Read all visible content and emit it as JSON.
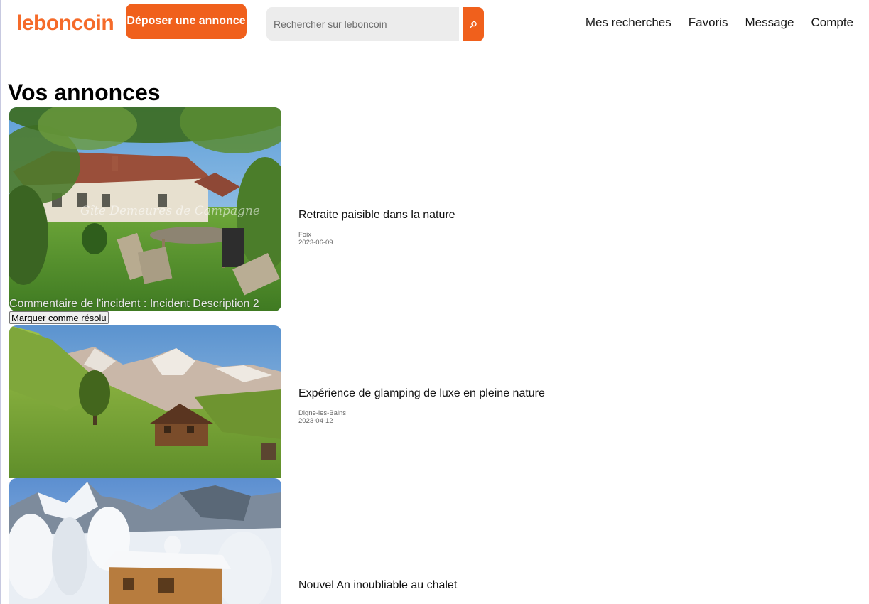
{
  "header": {
    "logo": "leboncoin",
    "post_button": "Déposer une annonce",
    "search_placeholder": "Rechercher sur leboncoin",
    "search_icon": "search-icon",
    "nav": [
      "Mes recherches",
      "Favoris",
      "Message",
      "Compte"
    ]
  },
  "colors": {
    "brand": "#f56b2a",
    "button": "#f0601c"
  },
  "main": {
    "title": "Vos annonces",
    "listings": [
      {
        "title": "Retraite paisible dans la nature",
        "city": "Foix",
        "date": "2023-06-09",
        "image": "cottage-garden-photo",
        "image_watermark": "Gîte Demeures de Campagne",
        "incident": "Commentaire de l'incident : Incident Description 2",
        "resolve_button": "Marquer comme résolu"
      },
      {
        "title": "Expérience de glamping de luxe en pleine nature",
        "city": "Digne-les-Bains",
        "date": "2023-04-12",
        "image": "mountain-cabin-photo"
      },
      {
        "title": "Nouvel An inoubliable au chalet",
        "image": "snowy-chalet-photo"
      }
    ]
  }
}
